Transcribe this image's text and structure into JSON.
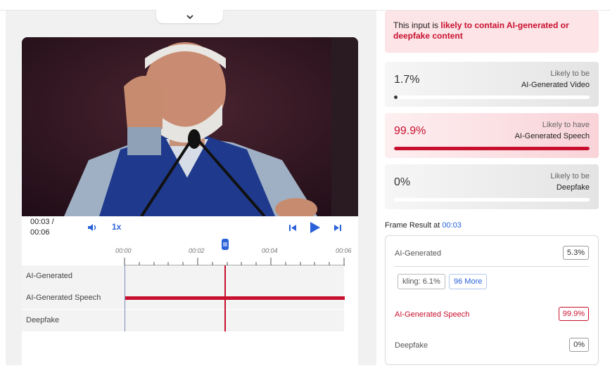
{
  "video": {
    "time_current": "00:03 /",
    "time_total": "00:06",
    "speed": "1x"
  },
  "timeline": {
    "ticks": [
      "00:00",
      "00:02",
      "00:04",
      "00:06"
    ],
    "tracks": [
      {
        "label": "AI-Generated"
      },
      {
        "label": "AI-Generated Speech"
      },
      {
        "label": "Deepfake"
      }
    ]
  },
  "banner": {
    "prefix": "This input is ",
    "highlight": "likely to contain AI-generated or deepfake content"
  },
  "metrics": [
    {
      "value": "1.7%",
      "line1": "Likely to be",
      "line2": "AI-Generated Video",
      "level": 0.017
    },
    {
      "value": "99.9%",
      "line1": "Likely to have",
      "line2": "AI-Generated Speech",
      "level": 0.999
    },
    {
      "value": "0%",
      "line1": "Likely to be",
      "line2": "Deepfake",
      "level": 0
    }
  ],
  "frame": {
    "title_prefix": "Frame Result at ",
    "time": "00:03",
    "rows": {
      "ai_generated": {
        "label": "AI-Generated",
        "value": "5.3%"
      },
      "speech": {
        "label": "AI-Generated Speech",
        "value": "99.9%"
      },
      "deepfake": {
        "label": "Deepfake",
        "value": "0%"
      }
    },
    "chips": {
      "kling": "kling: 6.1%",
      "more": "96 More"
    }
  },
  "colors": {
    "accent_red": "#c8102e",
    "accent_blue": "#2b62d9"
  },
  "icons": [
    "chevron-down-icon",
    "volume-icon",
    "skip-back-icon",
    "play-icon",
    "skip-forward-icon",
    "playhead-icon"
  ]
}
